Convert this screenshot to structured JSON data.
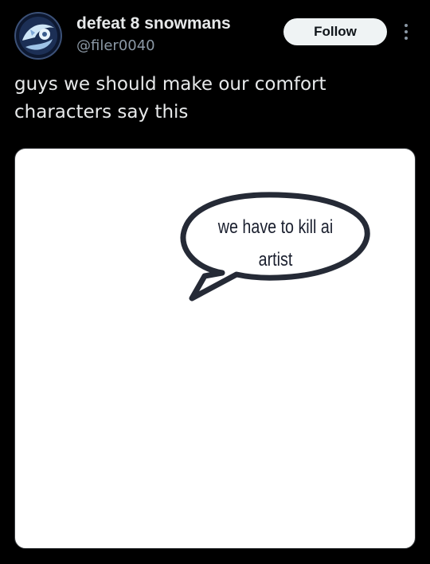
{
  "author": {
    "display_name": "defeat 8 snowmans",
    "handle": "@filer0040",
    "avatar_icon": "avatar-icon"
  },
  "header": {
    "follow_label": "Follow",
    "more_icon": "more-options-icon"
  },
  "tweet": {
    "text": "guys we should make our comfort characters say this"
  },
  "media": {
    "speech_bubble_text_line1": "we have to kill ai",
    "speech_bubble_text_line2": "artist"
  },
  "colors": {
    "background": "#000000",
    "text_primary": "#e7e9ea",
    "text_secondary": "#8b98a5",
    "button_bg": "#eff3f4",
    "button_text": "#0f1419",
    "bubble_stroke": "#252a36"
  }
}
